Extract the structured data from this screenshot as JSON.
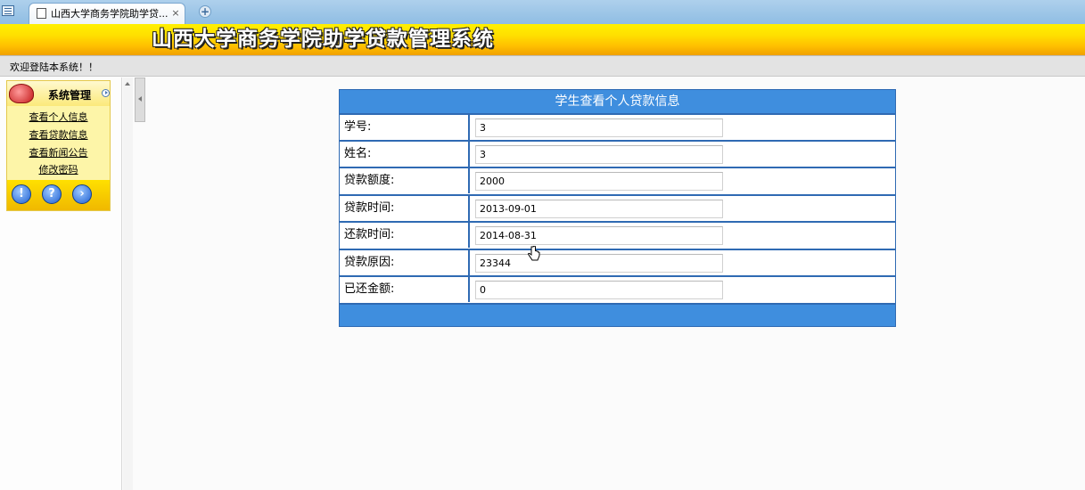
{
  "browser": {
    "tab_title": "山西大学商务学院助学贷...",
    "close_symbol": "×",
    "new_tab_symbol": "+"
  },
  "banner": {
    "title": "山西大学商务学院助学贷款管理系统"
  },
  "welcome": {
    "text": "欢迎登陆本系统！！"
  },
  "sidebar": {
    "title": "系统管理",
    "items": [
      {
        "label": "查看个人信息"
      },
      {
        "label": "查看贷款信息"
      },
      {
        "label": "查看新闻公告"
      },
      {
        "label": "修改密码"
      }
    ],
    "footer_buttons": [
      {
        "icon": "exclamation-icon",
        "symbol": "!"
      },
      {
        "icon": "help-icon",
        "symbol": "?"
      },
      {
        "icon": "arrow-right-icon",
        "symbol": "›"
      }
    ]
  },
  "loan_info": {
    "title": "学生查看个人贷款信息",
    "fields": [
      {
        "label": "学号:",
        "value": "3"
      },
      {
        "label": "姓名:",
        "value": "3"
      },
      {
        "label": "贷款额度:",
        "value": "2000"
      },
      {
        "label": "贷款时间:",
        "value": "2013-09-01"
      },
      {
        "label": "还款时间:",
        "value": "2014-08-31"
      },
      {
        "label": "贷款原因:",
        "value": "23344"
      },
      {
        "label": "已还金额:",
        "value": "0"
      }
    ]
  },
  "colors": {
    "header_blue": "#3f8ede",
    "border_blue": "#2f6ab3",
    "banner_yellow": "#ffd800",
    "menu_yellow": "#fdf5a8"
  }
}
